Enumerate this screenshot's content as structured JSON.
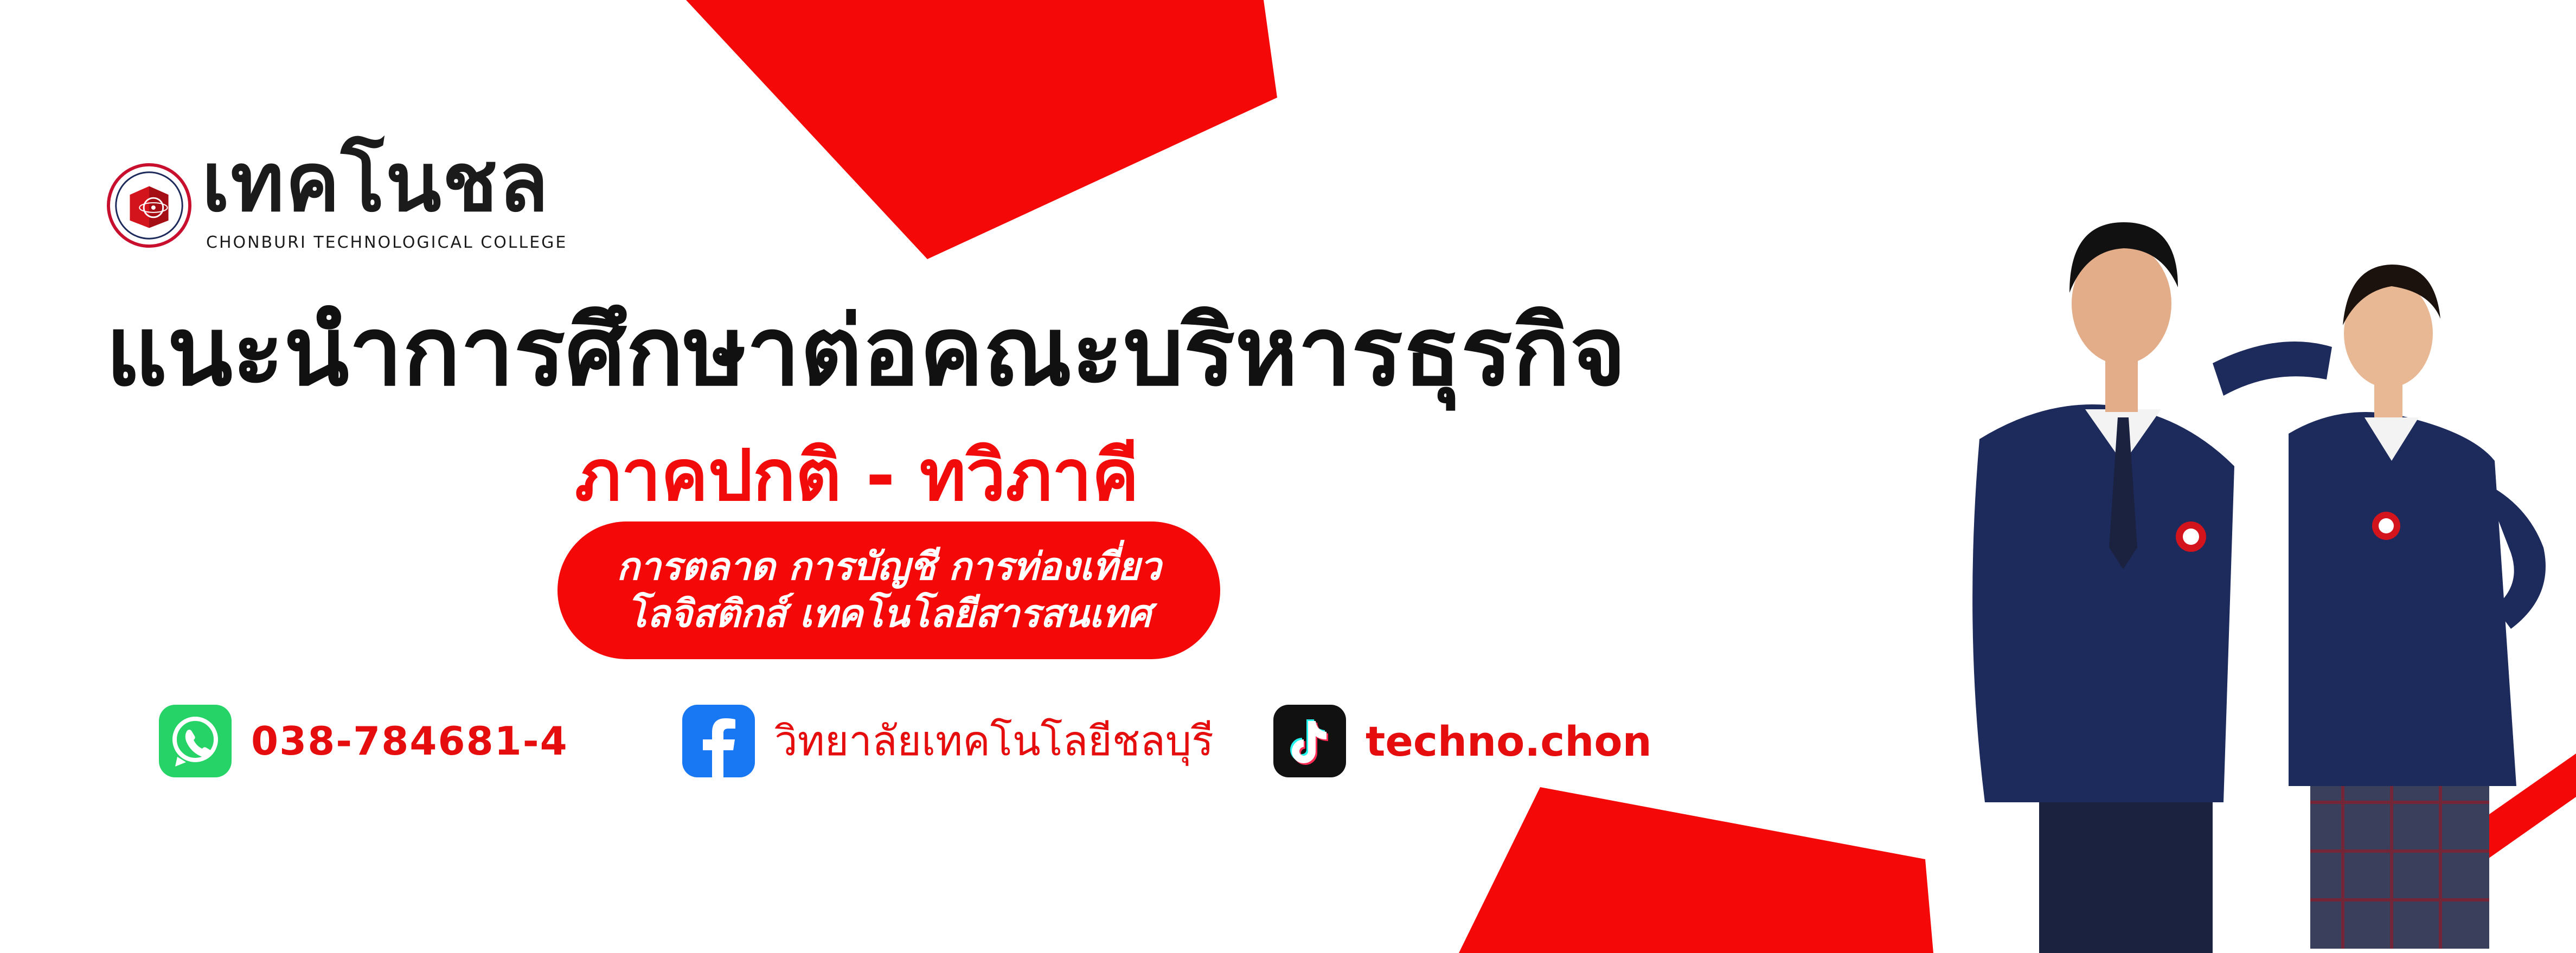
{
  "logo": {
    "wordmark": "เทคโนชล",
    "subtitle": "CHONBURI TECHNOLOGICAL COLLEGE"
  },
  "headline": "แนะนำการศึกษาต่อคณะบริหารธุรกิจ",
  "program_type": "ภาคปกติ - ทวิภาคี",
  "majors": {
    "line1": "การตลาด การบัญชี การท่องเที่ยว",
    "line2": "โลจิสติกส์ เทคโนโลยีสารสนเทศ"
  },
  "contacts": {
    "phone": {
      "icon": "whatsapp-icon",
      "text": "038-784681-4"
    },
    "facebook": {
      "icon": "facebook-icon",
      "text": "วิทยาลัยเทคโนโลยีชลบุรี"
    },
    "tiktok": {
      "icon": "tiktok-icon",
      "text": "techno.chon"
    }
  },
  "colors": {
    "accent_red": "#f40808",
    "text_dark": "#111111",
    "whatsapp_green": "#25d366",
    "facebook_blue": "#1877f2",
    "tiktok_black": "#111111",
    "uniform_navy": "#1c2a5c"
  }
}
